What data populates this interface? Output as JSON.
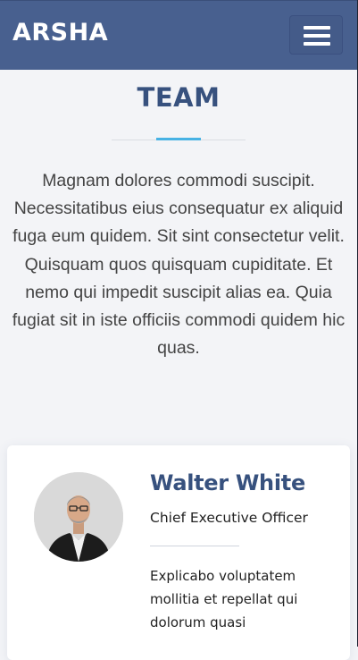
{
  "header": {
    "logo_text": "ARSHA",
    "menu_icon": "hamburger-menu-icon"
  },
  "team_section": {
    "title": "TEAM",
    "accent_color": "#47b2e4",
    "description": "Magnam dolores commodi suscipit. Necessitatibus eius consequatur ex aliquid fuga eum quidem. Sit sint consectetur velit. Quisquam quos quisquam cupiditate. Et nemo qui impedit suscipit alias ea. Quia fugiat sit in iste officiis commodi quidem hic quas.",
    "members": [
      {
        "name": "Walter White",
        "role": "Chief Executive Officer",
        "bio": "Explicabo voluptatem mollitia et repellat qui dolorum quasi"
      }
    ]
  },
  "colors": {
    "header_bg": "#48608f",
    "title_color": "#37517e",
    "page_bg": "#f3f4f7"
  }
}
